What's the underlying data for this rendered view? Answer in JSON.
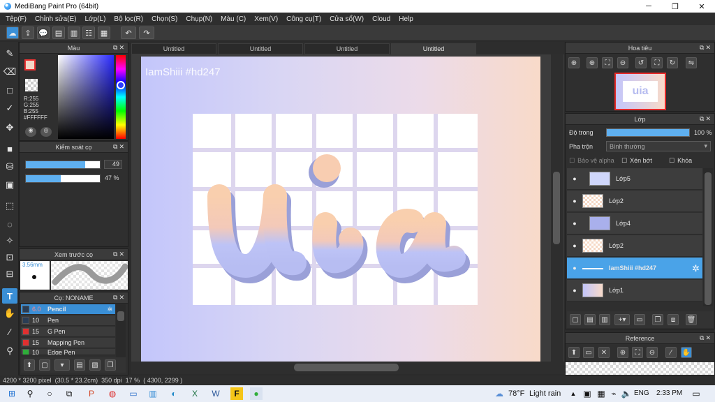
{
  "window": {
    "title": "MediBang Paint Pro (64bit)",
    "controls": [
      "─",
      "❐",
      "✕"
    ]
  },
  "menu": [
    "Tệp(F)",
    "Chỉnh sửa(E)",
    "Lớp(L)",
    "Bộ lọc(R)",
    "Chọn(S)",
    "Chụp(N)",
    "Màu (C)",
    "Xem(V)",
    "Công cụ(T)",
    "Cửa sổ(W)",
    "Cloud",
    "Help"
  ],
  "tabs": [
    "Untitled",
    "Untitled",
    "Untitled",
    "Untitled"
  ],
  "canvas": {
    "watermark": "IamShiii #hd247",
    "artwork_text": "uia"
  },
  "color_panel": {
    "title": "Màu",
    "rgb": {
      "r": "R:255",
      "g": "G:255",
      "b": "B:255",
      "hex": "#FFFFFF"
    }
  },
  "brush_control": {
    "title": "Kiểm soát cọ",
    "size_value": "49",
    "size_fraction": 0.8,
    "opacity_value": "47 %",
    "opacity_fraction": 0.47
  },
  "brush_preview": {
    "title": "Xem trước cọ",
    "size": "3.56mm"
  },
  "brush_list": {
    "title": "Cọ: NONAME",
    "items": [
      {
        "size": "6.0",
        "name": "Pencil",
        "color": "#2a3d55",
        "selected": true
      },
      {
        "size": "10",
        "name": "Pen",
        "color": "#2a3d55",
        "selected": false
      },
      {
        "size": "15",
        "name": "G Pen",
        "color": "#e03030",
        "selected": false
      },
      {
        "size": "15",
        "name": "Mapping Pen",
        "color": "#e03030",
        "selected": false
      },
      {
        "size": "10",
        "name": "Edge Pen",
        "color": "#2fae3a",
        "selected": false
      }
    ]
  },
  "navigator": {
    "title": "Hoa tiêu"
  },
  "layers_panel": {
    "title": "Lớp",
    "opacity_label": "Độ trong",
    "opacity_value": "100 %",
    "blend_label": "Pha trộn",
    "blend_value": "Bình thường",
    "protect_alpha": "Bảo vệ alpha",
    "clipping": "Xén bớt",
    "lock": "Khóa",
    "layers": [
      {
        "name": "Lớp5",
        "selected": false
      },
      {
        "name": "Lớp2",
        "selected": false
      },
      {
        "name": "Lớp4",
        "selected": false
      },
      {
        "name": "Lớp2",
        "selected": false
      },
      {
        "name": "IamShiii #hd247",
        "selected": true
      },
      {
        "name": "Lớp1",
        "selected": false
      }
    ]
  },
  "reference": {
    "title": "Reference"
  },
  "status": {
    "size": "4200 * 3200 pixel",
    "cm": "(30.5 * 23.2cm)",
    "dpi": "350 dpi",
    "zoom": "17 %",
    "coords": "( 4300, 2299 )"
  },
  "taskbar": {
    "temperature": "78°F",
    "weather": "Light rain",
    "language": "ENG",
    "time": "2:33 PM"
  }
}
